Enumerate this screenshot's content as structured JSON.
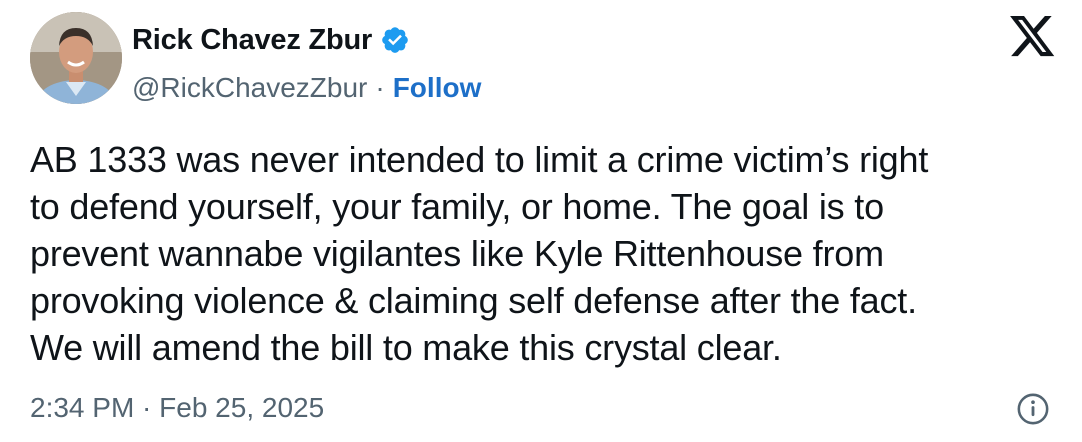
{
  "author": {
    "display_name": "Rick Chavez Zbur",
    "verified": true,
    "handle": "@RickChavezZbur",
    "separator": "·",
    "follow_label": "Follow"
  },
  "icons": {
    "avatar": "profile-photo",
    "verified": "verified-badge-icon",
    "brand": "x-logo-icon",
    "info": "info-icon"
  },
  "tweet": {
    "lines": [
      "AB 1333 was never intended to limit a crime victim’s right",
      "to defend yourself, your family, or home. The goal is to",
      "prevent wannabe vigilantes like Kyle Rittenhouse from",
      "provoking violence & claiming self defense after the fact.",
      "We will amend the bill to make this crystal clear."
    ],
    "timestamp": "2:34 PM · Feb 25, 2025"
  },
  "colors": {
    "text": "#0f1419",
    "secondary": "#536471",
    "follow": "#1d6fc8",
    "verified": "#1d9bf0"
  }
}
